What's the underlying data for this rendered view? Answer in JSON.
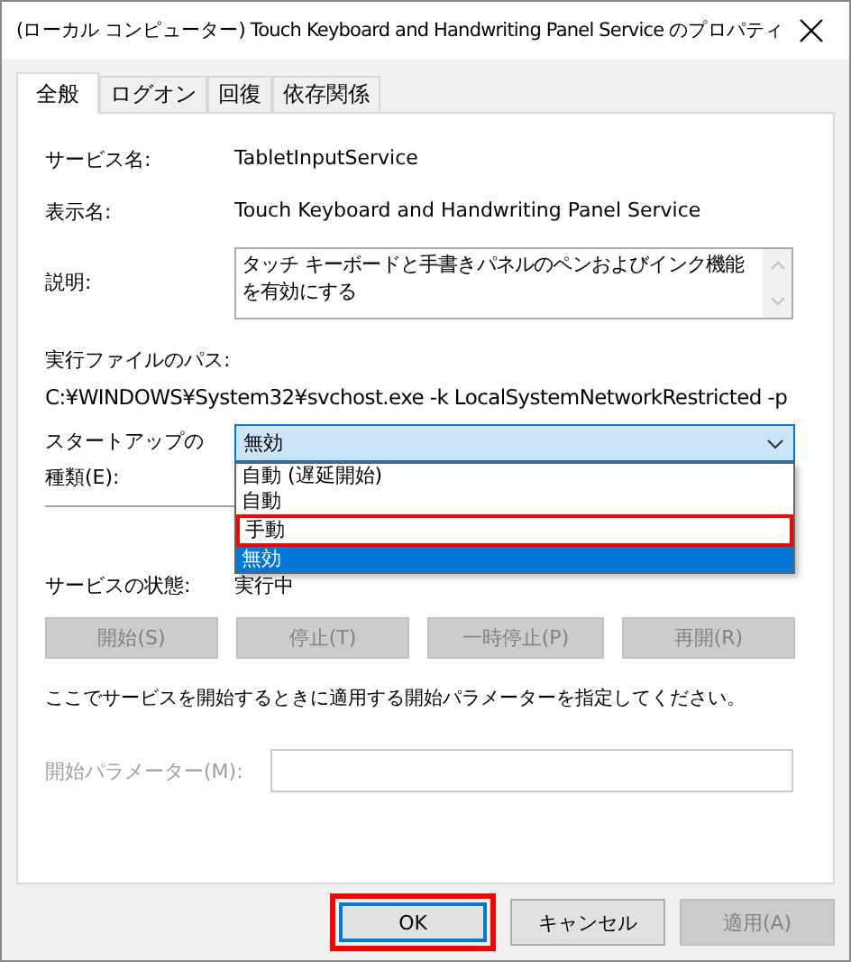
{
  "window": {
    "title": "(ローカル コンピューター) Touch Keyboard and Handwriting Panel Service のプロパティ"
  },
  "tabs": [
    {
      "label": "全般",
      "selected": true
    },
    {
      "label": "ログオン",
      "selected": false
    },
    {
      "label": "回復",
      "selected": false
    },
    {
      "label": "依存関係",
      "selected": false
    }
  ],
  "service_name": {
    "label": "サービス名:",
    "value": "TabletInputService"
  },
  "display_name": {
    "label": "表示名:",
    "value": "Touch Keyboard and Handwriting Panel Service"
  },
  "description": {
    "label": "説明:",
    "value": "タッチ キーボードと手書きパネルのペンおよびインク機能を有効にする"
  },
  "executable_path": {
    "label": "実行ファイルのパス:",
    "value": "C:¥WINDOWS¥System32¥svchost.exe -k LocalSystemNetworkRestricted -p"
  },
  "startup_type": {
    "label": "スタートアップの種類(E):",
    "value": "無効",
    "expanded": true,
    "options": [
      {
        "label": "自動 (遅延開始)",
        "selected": false,
        "highlighted": false
      },
      {
        "label": "自動",
        "selected": false,
        "highlighted": false
      },
      {
        "label": "手動",
        "selected": false,
        "highlighted": true
      },
      {
        "label": "無効",
        "selected": true,
        "highlighted": false
      }
    ]
  },
  "service_status": {
    "label": "サービスの状態:",
    "value": "実行中"
  },
  "control_buttons": [
    {
      "label": "開始(S)",
      "disabled": true
    },
    {
      "label": "停止(T)",
      "disabled": true
    },
    {
      "label": "一時停止(P)",
      "disabled": true
    },
    {
      "label": "再開(R)",
      "disabled": true
    }
  ],
  "note": "ここでサービスを開始するときに適用する開始パラメーターを指定してください。",
  "start_parameters": {
    "label": "開始パラメーター(M):",
    "disabled": true
  },
  "buttons": [
    {
      "label": "OK",
      "disabled": false,
      "default": true,
      "highlighted": true
    },
    {
      "label": "キャンセル",
      "disabled": false,
      "default": false,
      "highlighted": false
    },
    {
      "label": "適用(A)",
      "disabled": true,
      "default": false,
      "highlighted": false
    }
  ]
}
